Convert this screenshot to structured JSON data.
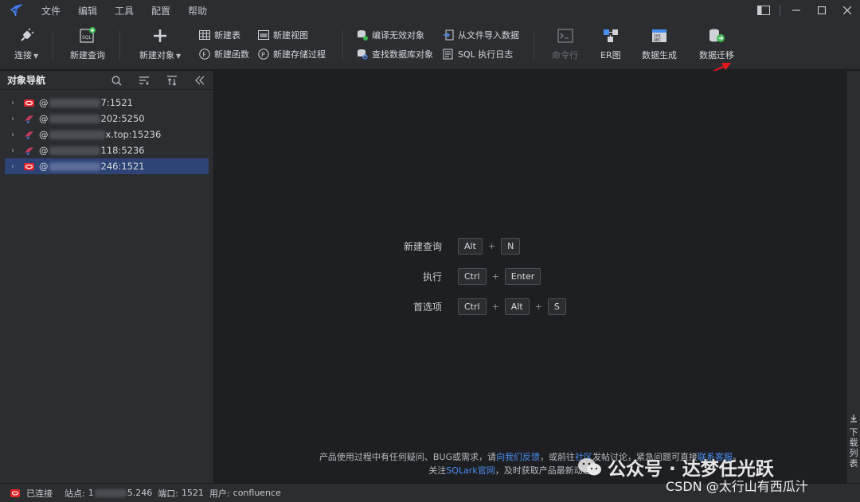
{
  "menubar": {
    "items": [
      "文件",
      "编辑",
      "工具",
      "配置",
      "帮助"
    ]
  },
  "toolbar": {
    "connect": "连接",
    "new_query": "新建查询",
    "new_object": "新建对象",
    "new_table": "新建表",
    "new_function": "新建函数",
    "new_view": "新建视图",
    "new_procedure": "新建存储过程",
    "compile_invalid": "编译无效对象",
    "find_db_object": "查找数据库对象",
    "import_from_file": "从文件导入数据",
    "sql_log": "SQL 执行日志",
    "command_line": "命令行",
    "er_diagram": "ER图",
    "data_generation": "数据生成",
    "data_migration": "数据迁移"
  },
  "sidebar": {
    "title": "对象导航",
    "connections": [
      {
        "prefix": "@",
        "suffix": "7:1521",
        "type": "oracle"
      },
      {
        "prefix": "@",
        "suffix": "202:5250",
        "type": "other"
      },
      {
        "prefix": "@",
        "suffix": "x.top:15236",
        "type": "other"
      },
      {
        "prefix": "@",
        "suffix": "118:5236",
        "type": "other"
      },
      {
        "prefix": "@",
        "suffix": "246:1521",
        "type": "oracle",
        "selected": true
      }
    ]
  },
  "shortcuts": [
    {
      "label": "新建查询",
      "keys": [
        "Alt",
        "N"
      ]
    },
    {
      "label": "执行",
      "keys": [
        "Ctrl",
        "Enter"
      ]
    },
    {
      "label": "首选项",
      "keys": [
        "Ctrl",
        "Alt",
        "S"
      ]
    }
  ],
  "footer": {
    "line1_a": "产品使用过程中有任何疑问、BUG或需求，请",
    "line1_link1": "向我们反馈",
    "line1_b": "，或前往",
    "line1_link2": "社区",
    "line1_c": "发帖讨论，紧急问题可直接",
    "line1_link3": "联系客服",
    "line1_d": "。",
    "line2_a": "关注",
    "line2_link": "SQLark官网",
    "line2_b": "，及时获取产品最新动态。"
  },
  "right_strip": {
    "label": "下载列表"
  },
  "statusbar": {
    "connected": "已连接",
    "site_label": "站点:",
    "site_prefix": "1",
    "site_suffix": "5.246",
    "port_label": "端口:",
    "port": "1521",
    "user_label": "用户:",
    "user": "confluence"
  },
  "watermark": {
    "text": "公众号 · 达梦任光跃",
    "csdn": "CSDN @太行山有西瓜汁"
  },
  "colors": {
    "accent": "#4a8df0",
    "selected": "#2e4477",
    "oracle_red": "#e0242b",
    "arrow_red": "#e8171b"
  }
}
